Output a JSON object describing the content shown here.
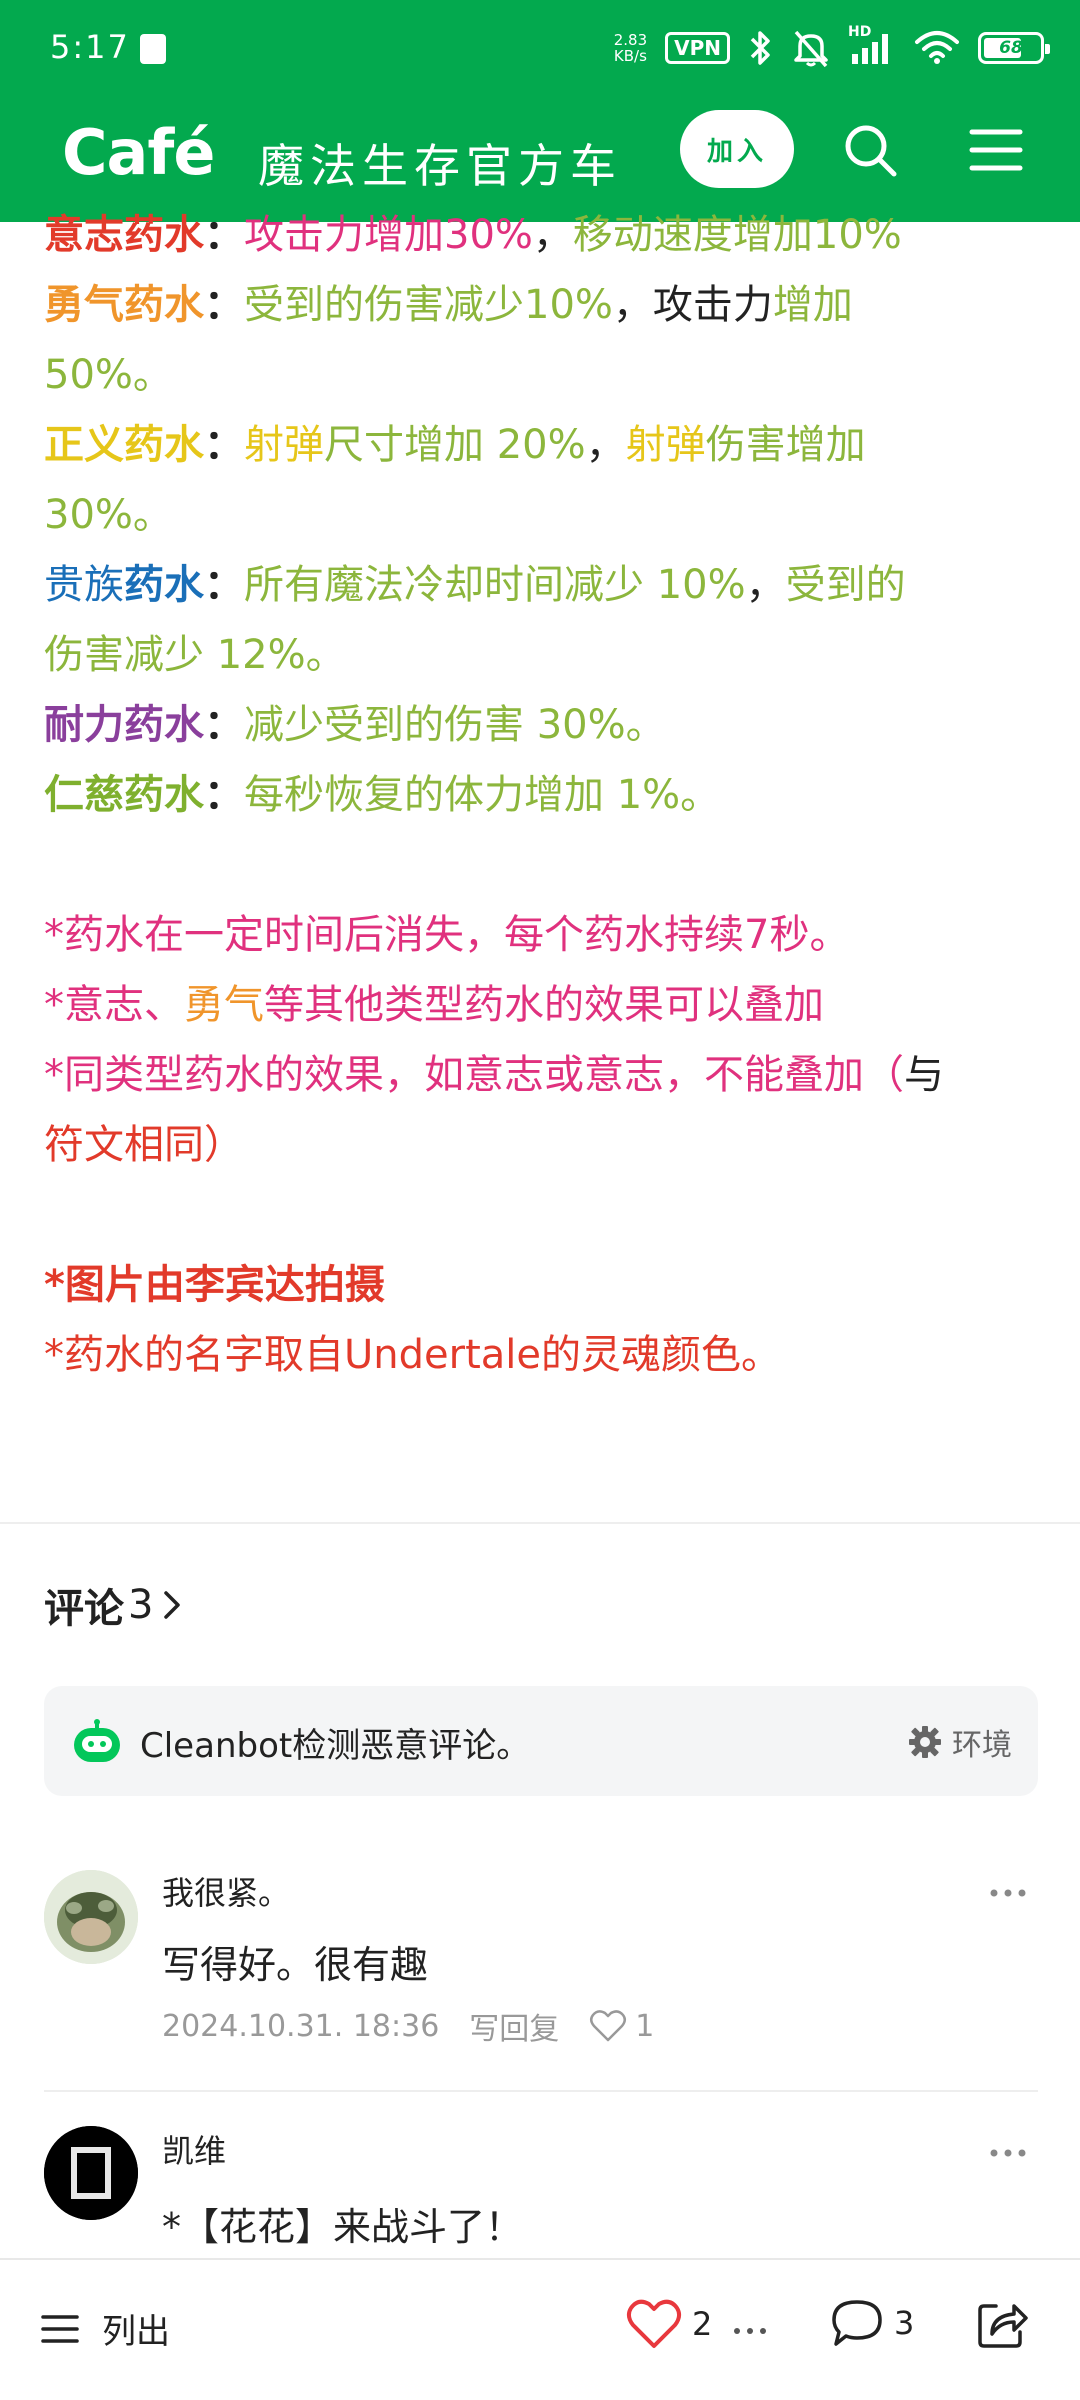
{
  "status": {
    "time": "5:17",
    "speed": "2.83",
    "speed_unit": "KB/s",
    "vpn": "VPN",
    "network": "HD",
    "battery": "68",
    "battery_level": 0.68
  },
  "header": {
    "brand": "Café",
    "cafe_name": "魔法生存官方车",
    "join_label": "加入"
  },
  "article": {
    "l1_name": "意志药水",
    "l1_colon": "：",
    "l1_a": "攻击力增加30%",
    "l1_sep": "，",
    "l1_b": "移动速度增加10%",
    "l2_name": "勇气药水",
    "l2_colon": "：",
    "l2_a": "受到的伤害减少10%",
    "l2_sep": "，",
    "l2_b": "攻击力",
    "l2_c": "增加",
    "l3": "50%。",
    "l4_name": "正义药水",
    "l4_colon": "：",
    "l4_a": "射弹",
    "l4_b": "尺寸增加 20%",
    "l4_sep": "，",
    "l4_c": "射弹",
    "l4_d": "伤害增加",
    "l5": "30%。",
    "l6_name_a": "贵族",
    "l6_name_b": "药水",
    "l6_colon": "：",
    "l6_a": "所有魔法冷却时间减少 10%",
    "l6_sep": "，",
    "l6_b": "受到的",
    "l7": "伤害减少 12%。",
    "l8_name": "耐力药水",
    "l8_colon": "：",
    "l8_a": "减少受到的伤害 30%。",
    "l9_name": "仁慈药水",
    "l9_colon": "：",
    "l9_a": "每秒恢复的体力增加 1%。",
    "n1": "*药水在一定时间后消失，每个药水持续7秒。",
    "n2_a": "*意志、",
    "n2_b": "勇气",
    "n2_c": "等其他类型药水的效果可以叠加",
    "n3_a": "*同类型药水的效果，如意志或意志，不能叠加（",
    "n3_b": "与",
    "n4": "符文相同）",
    "n5": "*图片由李宾达拍摄",
    "n6": "*药水的名字取自Undertale的灵魂颜色。"
  },
  "comments": {
    "title": "评论",
    "count": "3",
    "cleanbot_text": "Cleanbot检测恶意评论。",
    "cleanbot_settings": "环境",
    "items": [
      {
        "author": "我很紧。",
        "text": "写得好。很有趣",
        "date": "2024.10.31. 18:36",
        "reply": "写回复",
        "likes": "1"
      },
      {
        "author": "凯维",
        "text": "*【花花】来战斗了！"
      }
    ]
  },
  "bottombar": {
    "list_label": "列出",
    "likes": "2",
    "comments": "3"
  }
}
